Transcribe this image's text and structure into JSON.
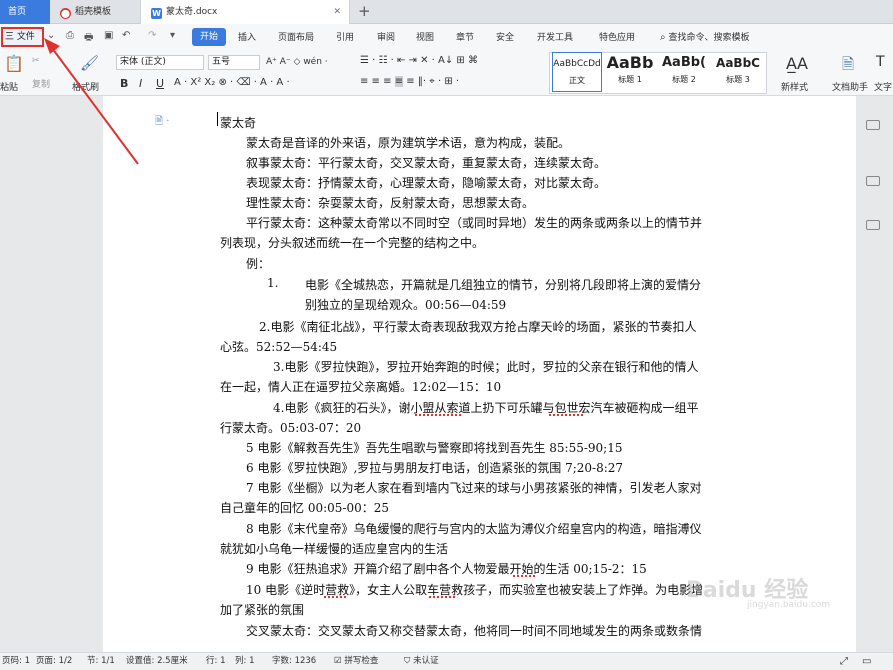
{
  "tabs": {
    "home": "首页",
    "template": "稻壳模板",
    "document": "蒙太奇.docx",
    "add": "+"
  },
  "menu": {
    "file": "三 文件",
    "start": "开始",
    "items": [
      "插入",
      "页面布局",
      "引用",
      "审阅",
      "视图",
      "章节",
      "安全",
      "开发工具",
      "特色应用"
    ],
    "search": "查找命令、搜索模板"
  },
  "ribbon": {
    "paste": "粘贴",
    "format_painter": "格式刷",
    "copy": "复制",
    "font_name": "宋体 (正文)",
    "font_size": "五号",
    "bold": "B",
    "italic": "I",
    "underline": "U",
    "styles": [
      {
        "sample": "AaBbCcDd",
        "label": "正文"
      },
      {
        "sample": "AaBb",
        "label": "标题 1"
      },
      {
        "sample": "AaBb(",
        "label": "标题 2"
      },
      {
        "sample": "AaBbC",
        "label": "标题 3"
      }
    ],
    "new_style": "新样式",
    "doc_assistant": "文档助手",
    "text_tool": "文字"
  },
  "document": {
    "lines": [
      "蒙太奇",
      "蒙太奇是音译的外来语，原为建筑学术语，意为构成，装配。",
      "叙事蒙太奇：平行蒙太奇，交叉蒙太奇，重复蒙太奇，连续蒙太奇。",
      "表现蒙太奇：抒情蒙太奇，心理蒙太奇，隐喻蒙太奇，对比蒙太奇。",
      "理性蒙太奇：杂耍蒙太奇，反射蒙太奇，思想蒙太奇。",
      "平行蒙太奇：这种蒙太奇常以不同时空（或同时异地）发生的两条或两条以上的情节并",
      "列表现，分头叙述而统一在一个完整的结构之中。",
      "例：",
      "1.",
      "电影《全城热恋，开篇就是几组独立的情节，分别将几段即将上演的爱情分",
      "别独立的呈现给观众。00:56—04:59",
      "2.电影《南征北战》，平行蒙太奇表现敌我双方抢占摩天岭的场面，紧张的节奏扣人",
      "心弦。52:52—54:45",
      "3.电影《罗拉快跑》，罗拉开始奔跑的时候；此时，罗拉的父亲在银行和他的情人",
      "在一起，情人正在逼罗拉父亲离婚。12:02—15：10",
      "4.电影《疯狂的石头》，谢小盟从索道上扔下可乐罐与包世宏汽车被砸构成一组平",
      "行蒙太奇。05:03-07：20",
      "5 电影《解救吾先生》吾先生唱歌与警察即将找到吾先生 85:55-90;15",
      "6 电影《罗拉快跑》,罗拉与男朋友打电话，创造紧张的氛围 7;20-8:27",
      "7 电影《坐橱》以为老人家在看到墙内飞过来的球与小男孩紧张的神情，引发老人家对",
      "自己童年的回忆 00:05-00：25",
      "8 电影《末代皇帝》乌龟缓慢的爬行与宫内的太监为溥仪介绍皇宫内的构造，暗指溥仪",
      "就犹如小乌龟一样缓慢的适应皇宫内的生活",
      "9 电影《狂热追求》开篇介绍了剧中各个人物爱最开始的生活 00;15-2：15",
      "10 电影《逆时营救》，女主人公取车营救孩子，而实验室也被安装上了炸弹。为电影增",
      "加了紧张的氛围",
      "交叉蒙太奇：交叉蒙太奇又称交替蒙太奇，他将同一时间不同地域发生的两条或数条情"
    ]
  },
  "watermark": {
    "text": "Baidu 经验",
    "sub": "jingyan.baidu.com"
  },
  "status": {
    "page_code": "页码: 1",
    "pages": "页面: 1/2",
    "section": "节: 1/1",
    "setting": "设置值: 2.5厘米",
    "row": "行: 1",
    "col": "列: 1",
    "words": "字数: 1236",
    "spell": "拼写检查",
    "cert": "未认证"
  },
  "colors": {
    "accent": "#3b7be0",
    "highlight_box": "#e0322c",
    "arrow": "#e0322c"
  }
}
